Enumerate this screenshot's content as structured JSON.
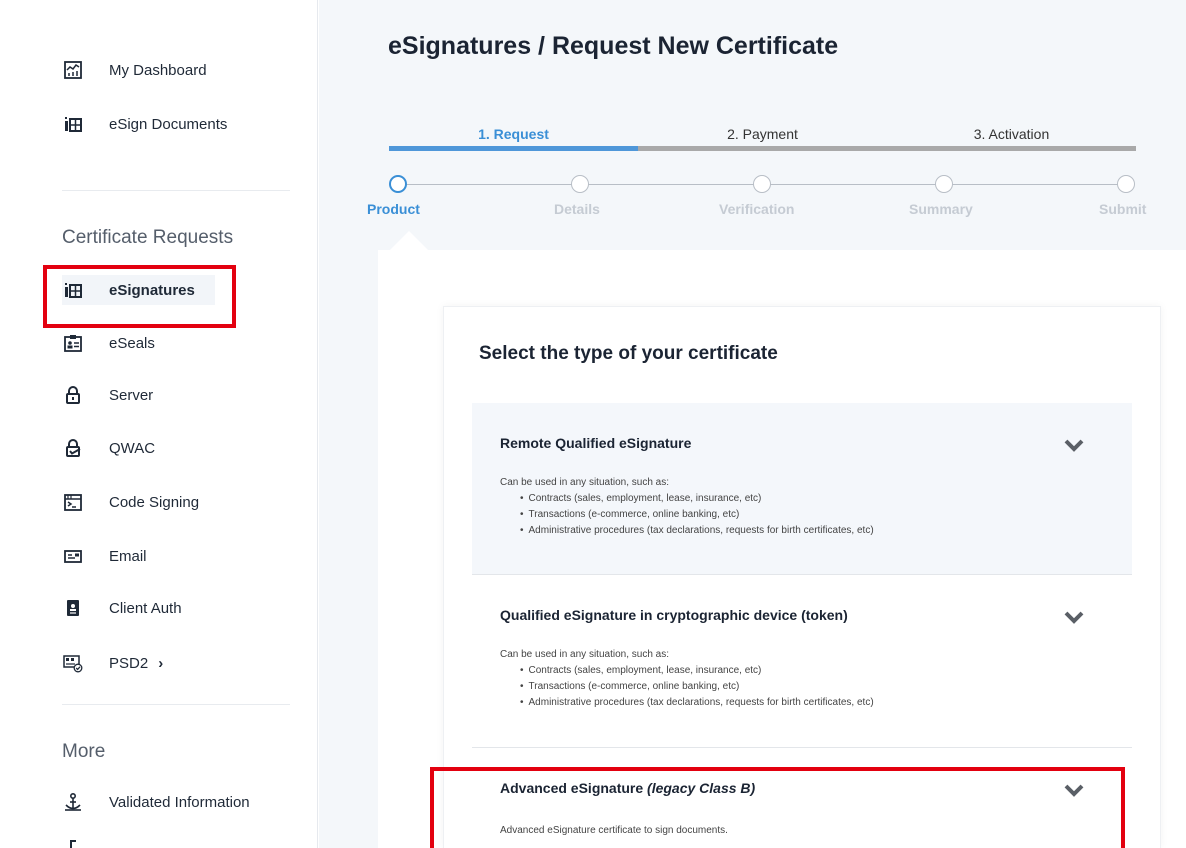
{
  "sidebar": {
    "top_items": [
      {
        "label": "My Dashboard",
        "icon": "dashboard-chart-icon"
      },
      {
        "label": "eSign Documents",
        "icon": "esign-documents-icon"
      }
    ],
    "cert_section_title": "Certificate Requests",
    "cert_items": [
      {
        "label": "eSignatures",
        "icon": "esignature-icon",
        "active": true
      },
      {
        "label": "eSeals",
        "icon": "id-card-icon"
      },
      {
        "label": "Server",
        "icon": "lock-icon"
      },
      {
        "label": "QWAC",
        "icon": "lock-check-icon"
      },
      {
        "label": "Code Signing",
        "icon": "terminal-window-icon"
      },
      {
        "label": "Email",
        "icon": "email-card-icon"
      },
      {
        "label": "Client Auth",
        "icon": "badge-icon"
      },
      {
        "label": "PSD2",
        "icon": "psd2-cards-icon",
        "chevron": "›"
      }
    ],
    "more_section_title": "More",
    "more_items": [
      {
        "label": "Validated Information",
        "icon": "anchor-person-icon"
      }
    ]
  },
  "main": {
    "title": "eSignatures / Request New Certificate",
    "steps": [
      {
        "label": "1. Request",
        "active": true
      },
      {
        "label": "2. Payment"
      },
      {
        "label": "3. Activation"
      }
    ],
    "step_progress": 0.333,
    "substeps": [
      {
        "label": "Product",
        "active": true
      },
      {
        "label": "Details"
      },
      {
        "label": "Verification"
      },
      {
        "label": "Summary"
      },
      {
        "label": "Submit"
      }
    ],
    "card_title": "Select the type of your certificate",
    "options": [
      {
        "title": "Remote Qualified eSignature",
        "intro": "Can be used in any situation, such as:",
        "bullets": [
          "Contracts (sales, employment, lease, insurance, etc)",
          "Transactions (e-commerce, online banking, etc)",
          "Administrative procedures (tax declarations, requests for birth certificates, etc)"
        ]
      },
      {
        "title": "Qualified eSignature in cryptographic device (token)",
        "intro": "Can be used in any situation, such as:",
        "bullets": [
          "Contracts (sales, employment, lease, insurance, etc)",
          "Transactions (e-commerce, online banking, etc)",
          "Administrative procedures (tax declarations, requests for birth certificates, etc)"
        ]
      },
      {
        "title": "Advanced eSignature",
        "title_suffix": "(legacy Class B)",
        "intro": "Advanced eSignature certificate to sign documents."
      }
    ]
  },
  "colors": {
    "accent": "#3a8fd6",
    "highlight_box": "#e3000f",
    "progress_inactive": "#a9a9a9"
  }
}
